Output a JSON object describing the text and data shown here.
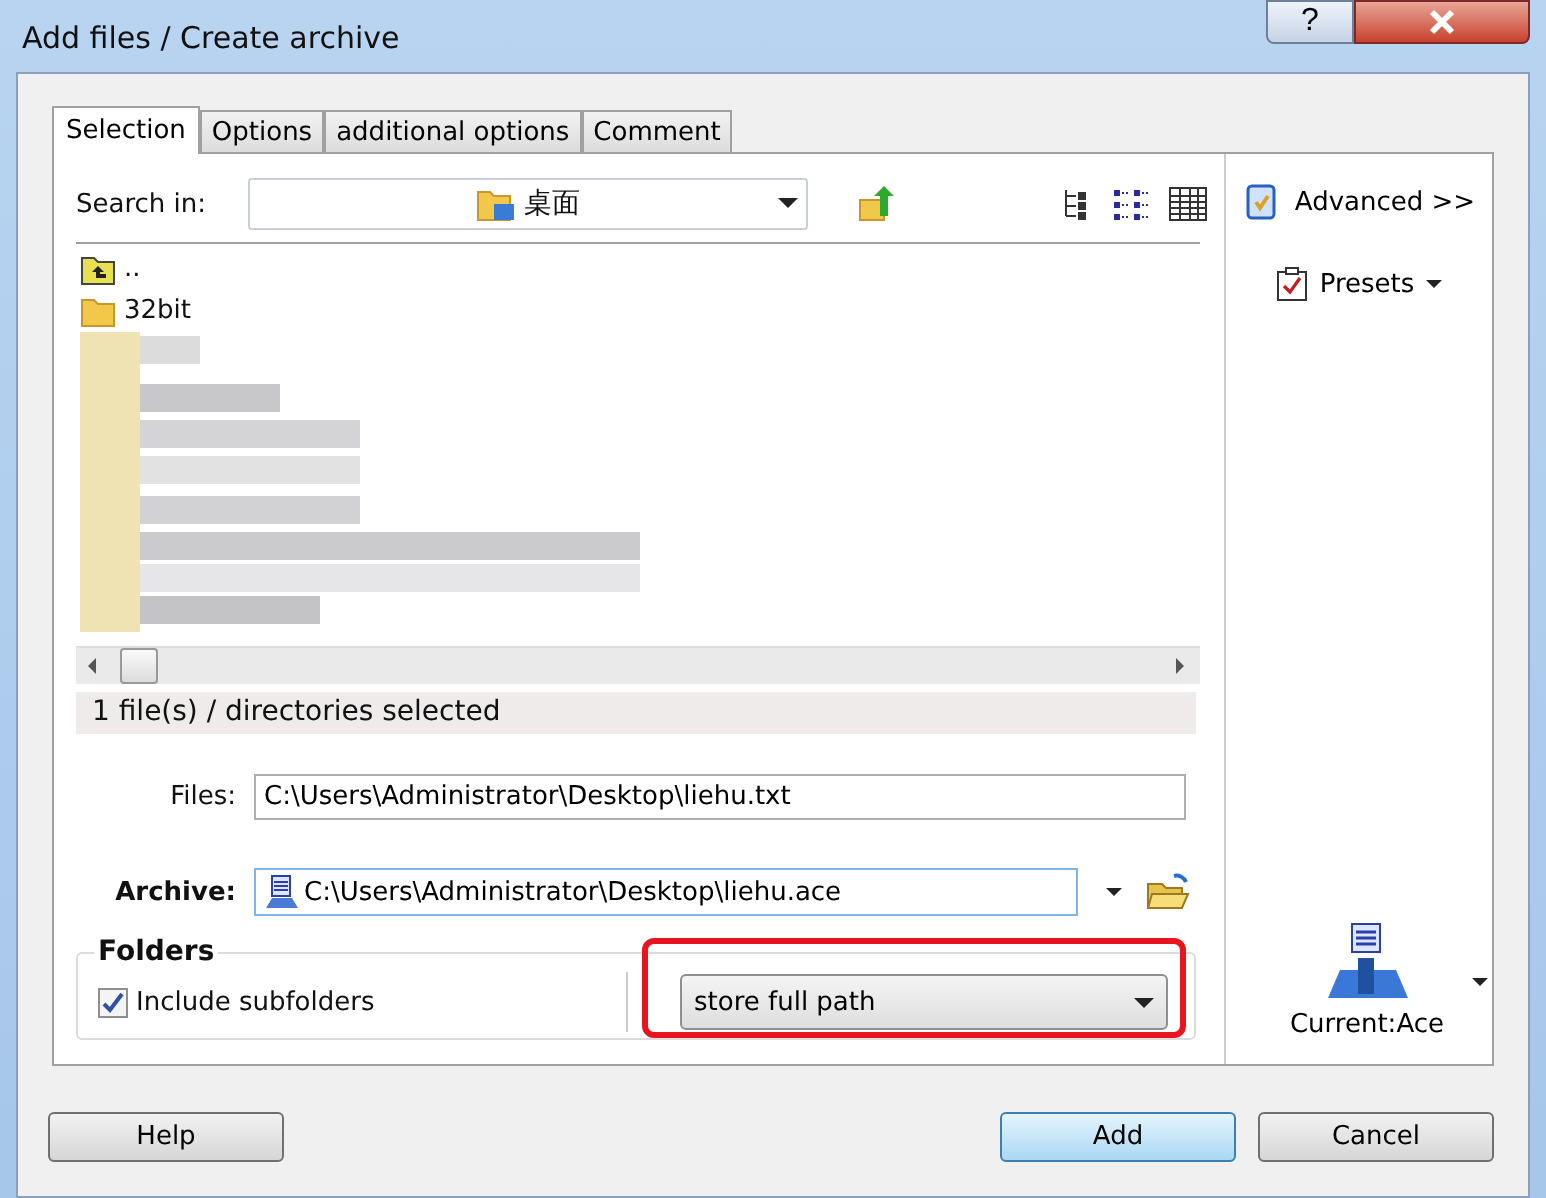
{
  "window": {
    "title": "Add files / Create archive",
    "help_glyph": "?"
  },
  "tabs": [
    {
      "label": "Selection",
      "selected": true
    },
    {
      "label": "Options",
      "selected": false
    },
    {
      "label": "additional options",
      "selected": false
    },
    {
      "label": "Comment",
      "selected": false
    }
  ],
  "search": {
    "label": "Search in:",
    "value": "桌面"
  },
  "file_list": {
    "items": [
      {
        "name": "..",
        "kind": "up"
      },
      {
        "name": "32bit",
        "kind": "folder"
      }
    ]
  },
  "status": "1 file(s) / directories selected",
  "files": {
    "label": "Files:",
    "value": "C:\\Users\\Administrator\\Desktop\\liehu.txt"
  },
  "archive": {
    "label": "Archive:",
    "value": "C:\\Users\\Administrator\\Desktop\\liehu.ace"
  },
  "folders": {
    "title": "Folders",
    "include_subfolders": {
      "label": "Include subfolders",
      "checked": true
    },
    "path_mode": "store full path",
    "highlighted": true
  },
  "side": {
    "advanced": "Advanced >>",
    "presets": "Presets",
    "archiver": "Current:Ace"
  },
  "buttons": [
    {
      "label": "Help",
      "default": false
    },
    {
      "label": "Add",
      "default": true
    },
    {
      "label": "Cancel",
      "default": false
    }
  ]
}
